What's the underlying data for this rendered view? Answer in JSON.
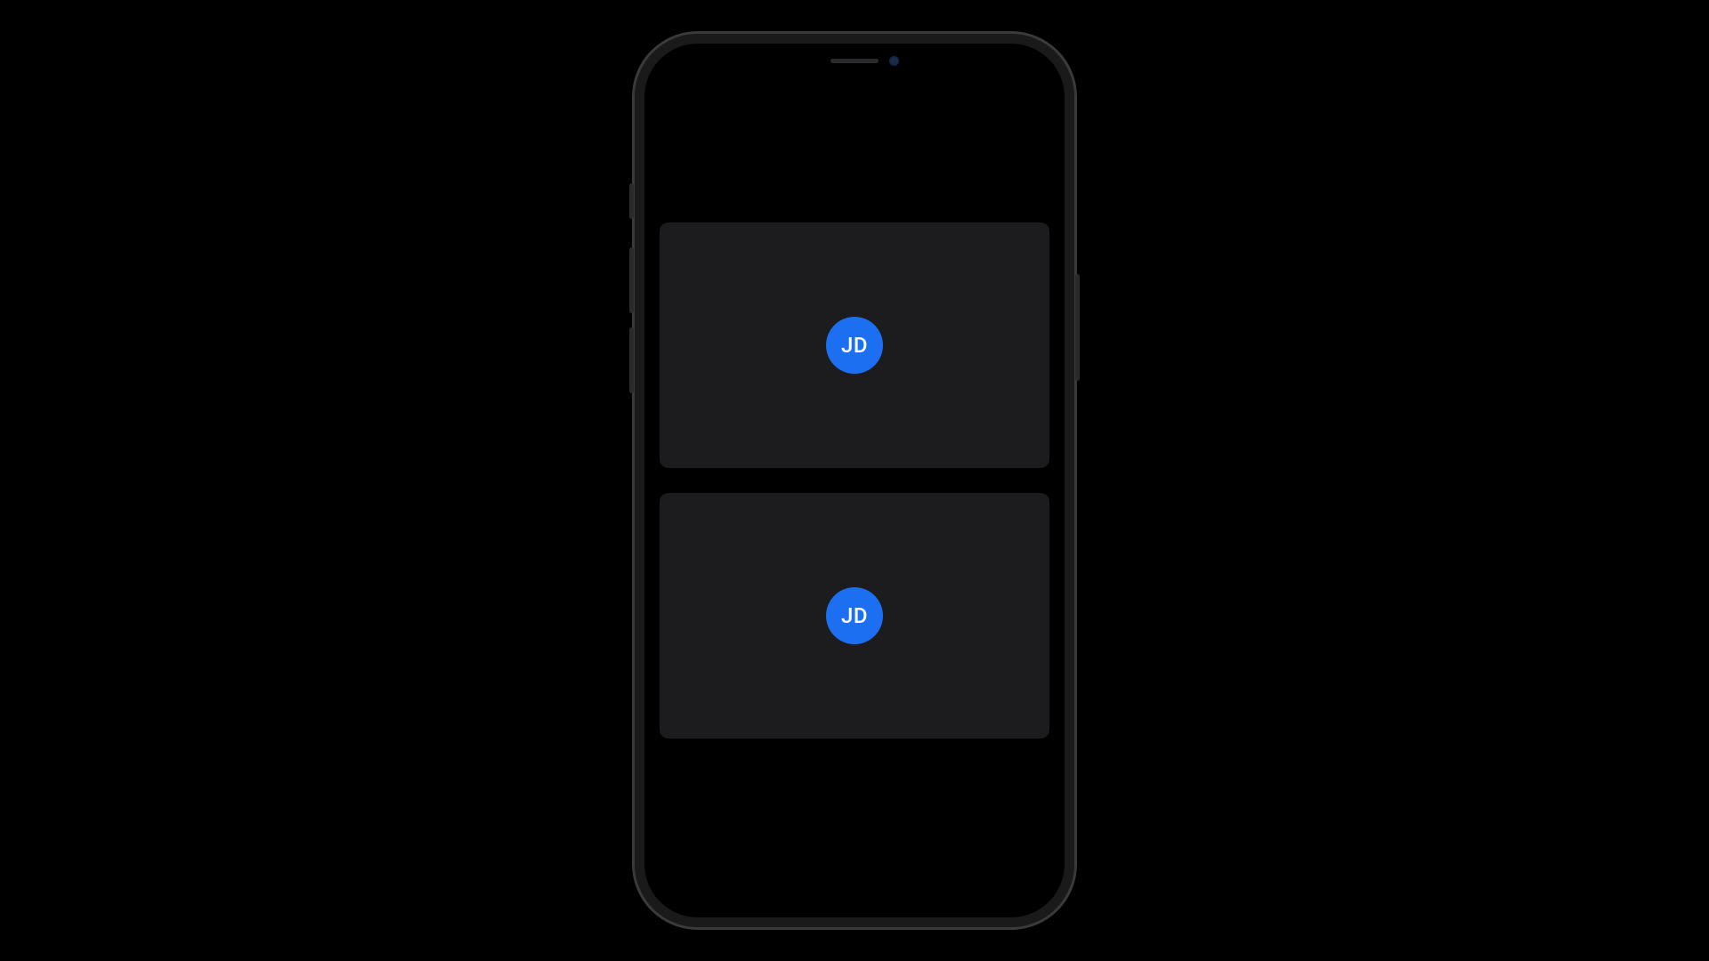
{
  "video_tiles": [
    {
      "initials": "JD"
    },
    {
      "initials": "JD"
    }
  ],
  "colors": {
    "avatar_bg": "#1d6ff2",
    "tile_bg": "#1c1c1e",
    "screen_bg": "#000000"
  }
}
